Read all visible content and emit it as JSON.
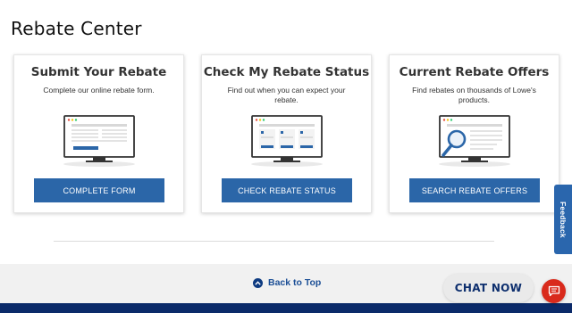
{
  "page": {
    "title": "Rebate Center"
  },
  "cards": [
    {
      "title": "Submit Your Rebate",
      "description": "Complete our online rebate form.",
      "button_label": "COMPLETE FORM",
      "illustration": "monitor-form-icon"
    },
    {
      "title": "Check My Rebate Status",
      "description": "Find out when you can expect your rebate.",
      "button_label": "CHECK REBATE STATUS",
      "illustration": "monitor-status-icon"
    },
    {
      "title": "Current Rebate Offers",
      "description": "Find rebates on thousands of Lowe's products.",
      "button_label": "SEARCH REBATE OFFERS",
      "illustration": "monitor-search-icon"
    }
  ],
  "footer": {
    "back_to_top": "Back to Top",
    "chat_now": "CHAT NOW",
    "feedback": "Feedback"
  },
  "colors": {
    "button_blue": "#2b66a8",
    "footer_navy": "#0b2a69",
    "chat_red": "#d92a1c",
    "feedback_blue": "#2a66ad"
  }
}
